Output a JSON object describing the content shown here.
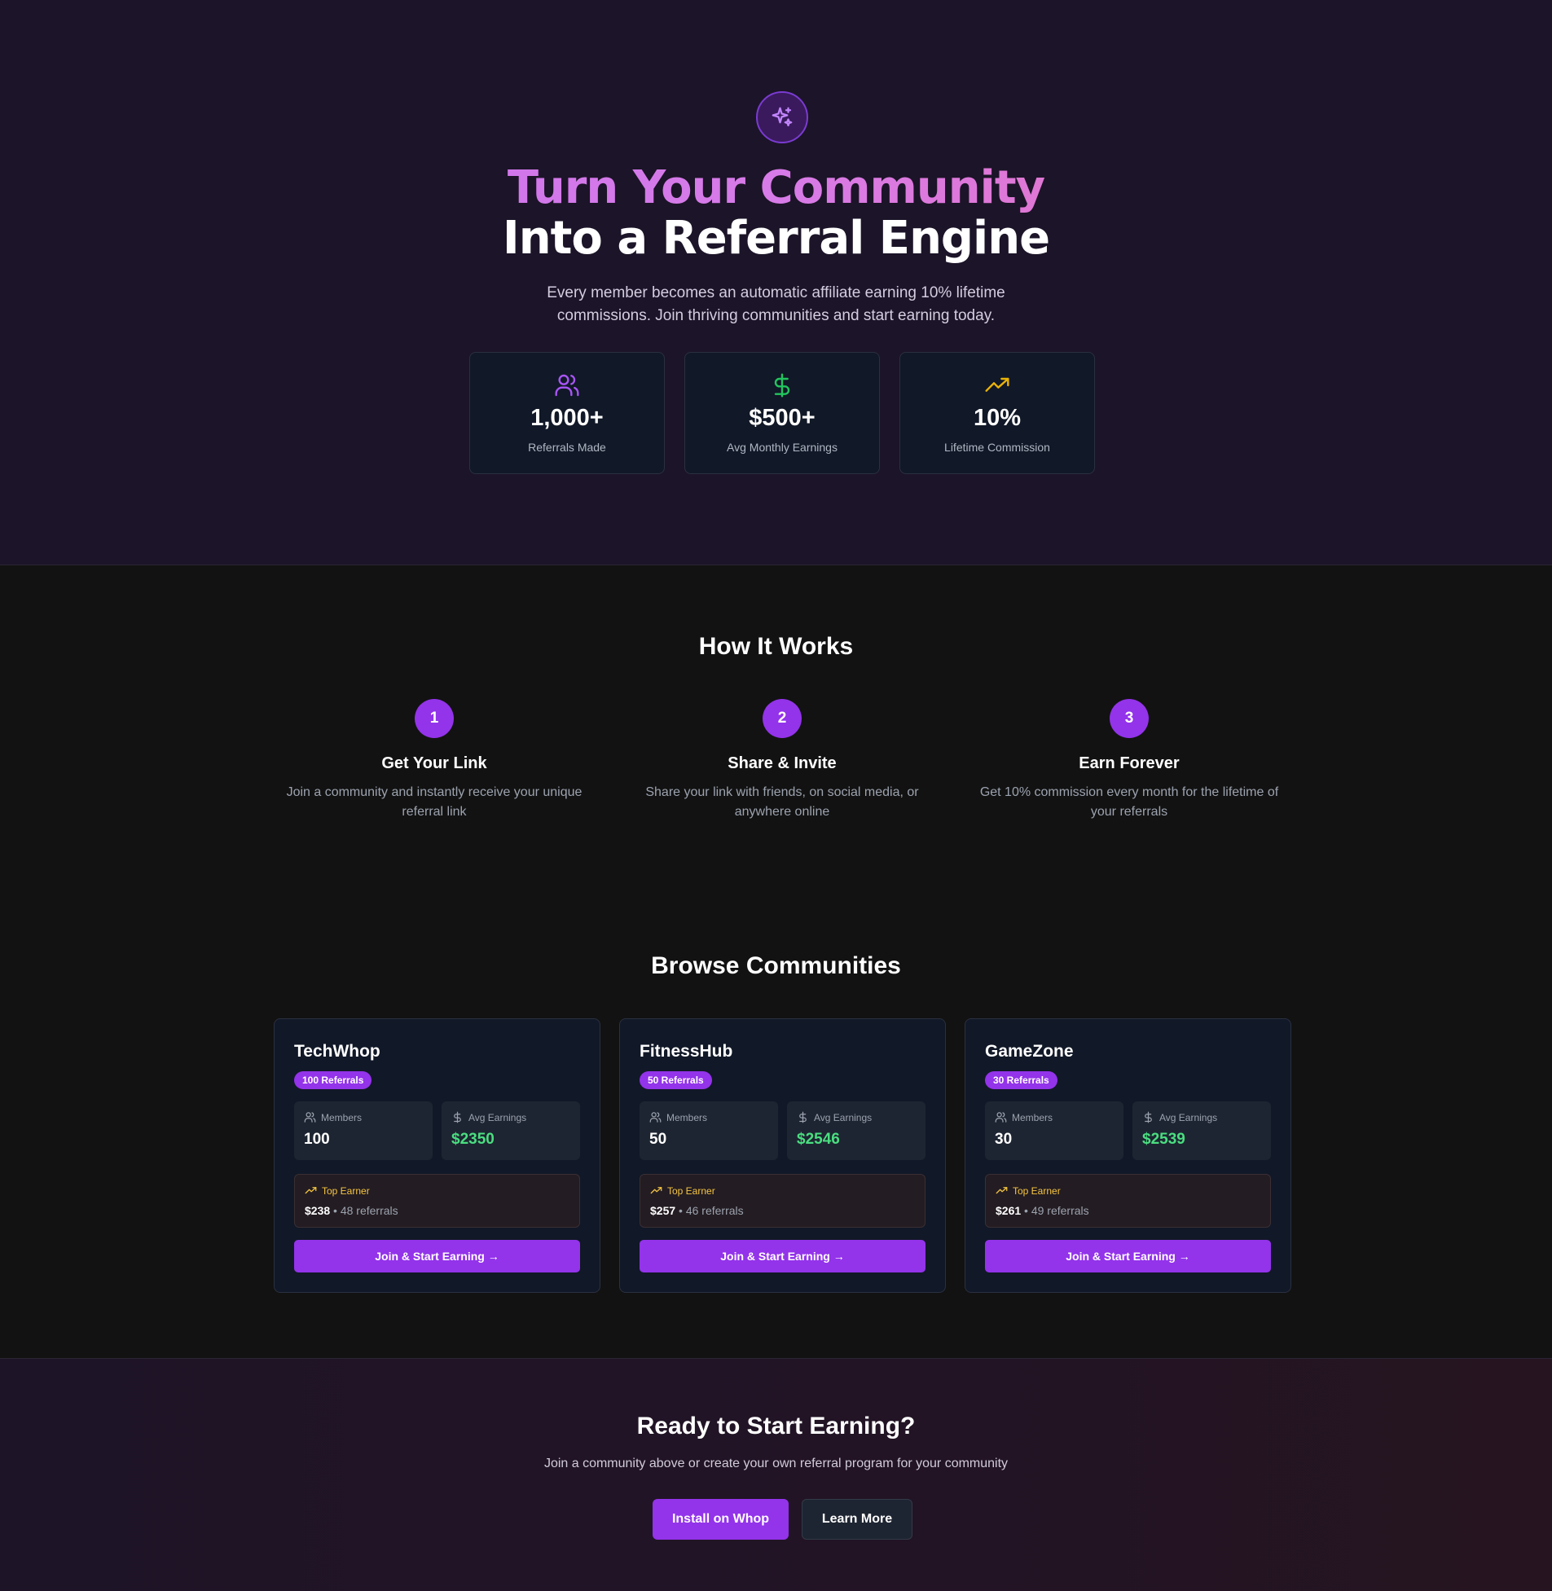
{
  "hero": {
    "title_line1": "Turn Your Community",
    "title_line2": "Into a Referral Engine",
    "subtitle": "Every member becomes an automatic affiliate earning 10% lifetime commissions. Join thriving communities and start earning today.",
    "stats": [
      {
        "icon": "users-icon",
        "value": "1,000+",
        "label": "Referrals Made",
        "color": "#a855f7"
      },
      {
        "icon": "dollar-icon",
        "value": "$500+",
        "label": "Avg Monthly Earnings",
        "color": "#22c55e"
      },
      {
        "icon": "trending-up-icon",
        "value": "10%",
        "label": "Lifetime Commission",
        "color": "#eab308"
      }
    ]
  },
  "how_it_works": {
    "title": "How It Works",
    "steps": [
      {
        "num": "1",
        "title": "Get Your Link",
        "desc": "Join a community and instantly receive your unique referral link"
      },
      {
        "num": "2",
        "title": "Share & Invite",
        "desc": "Share your link with friends, on social media, or anywhere online"
      },
      {
        "num": "3",
        "title": "Earn Forever",
        "desc": "Get 10% commission every month for the lifetime of your referrals"
      }
    ]
  },
  "communities": {
    "title": "Browse Communities",
    "members_label": "Members",
    "earnings_label": "Avg Earnings",
    "top_earner_label": "Top Earner",
    "join_label": "Join & Start Earning →",
    "items": [
      {
        "name": "TechWhop",
        "badge": "100 Referrals",
        "members": "100",
        "avg_earnings": "$2350",
        "top_amount": "$238",
        "top_referrals": " • 48 referrals"
      },
      {
        "name": "FitnessHub",
        "badge": "50 Referrals",
        "members": "50",
        "avg_earnings": "$2546",
        "top_amount": "$257",
        "top_referrals": " • 46 referrals"
      },
      {
        "name": "GameZone",
        "badge": "30 Referrals",
        "members": "30",
        "avg_earnings": "$2539",
        "top_amount": "$261",
        "top_referrals": " • 49 referrals"
      }
    ]
  },
  "cta": {
    "title": "Ready to Start Earning?",
    "subtitle": "Join a community above or create your own referral program for your community",
    "primary_label": "Install on Whop",
    "secondary_label": "Learn More"
  },
  "colors": {
    "accent": "#9333ea",
    "green": "#4ade80",
    "gold": "#f5c542"
  }
}
